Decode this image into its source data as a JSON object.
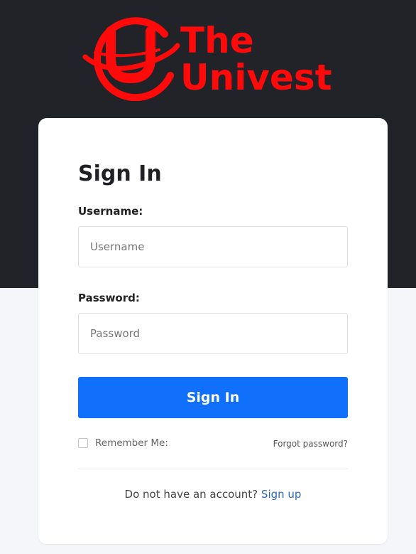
{
  "brand": {
    "logo_text_line1": "The",
    "logo_text_line2": "Univest",
    "logo_color": "#ff0a0a",
    "logo_mark_icon": "u-globe-logo-icon"
  },
  "colors": {
    "header_bg": "#212329",
    "page_bg": "#f4f6f9",
    "primary_button": "#1170fb",
    "link": "#2f68b4"
  },
  "form": {
    "title": "Sign In",
    "username_label": "Username:",
    "username_placeholder": "Username",
    "username_value": "",
    "password_label": "Password:",
    "password_placeholder": "Password",
    "password_value": "",
    "submit_label": "Sign In",
    "remember_label": "Remember Me:",
    "remember_checked": false,
    "forgot_label": "Forgot password?",
    "signup_prompt": "Do not have an account?",
    "signup_link": "Sign up"
  }
}
